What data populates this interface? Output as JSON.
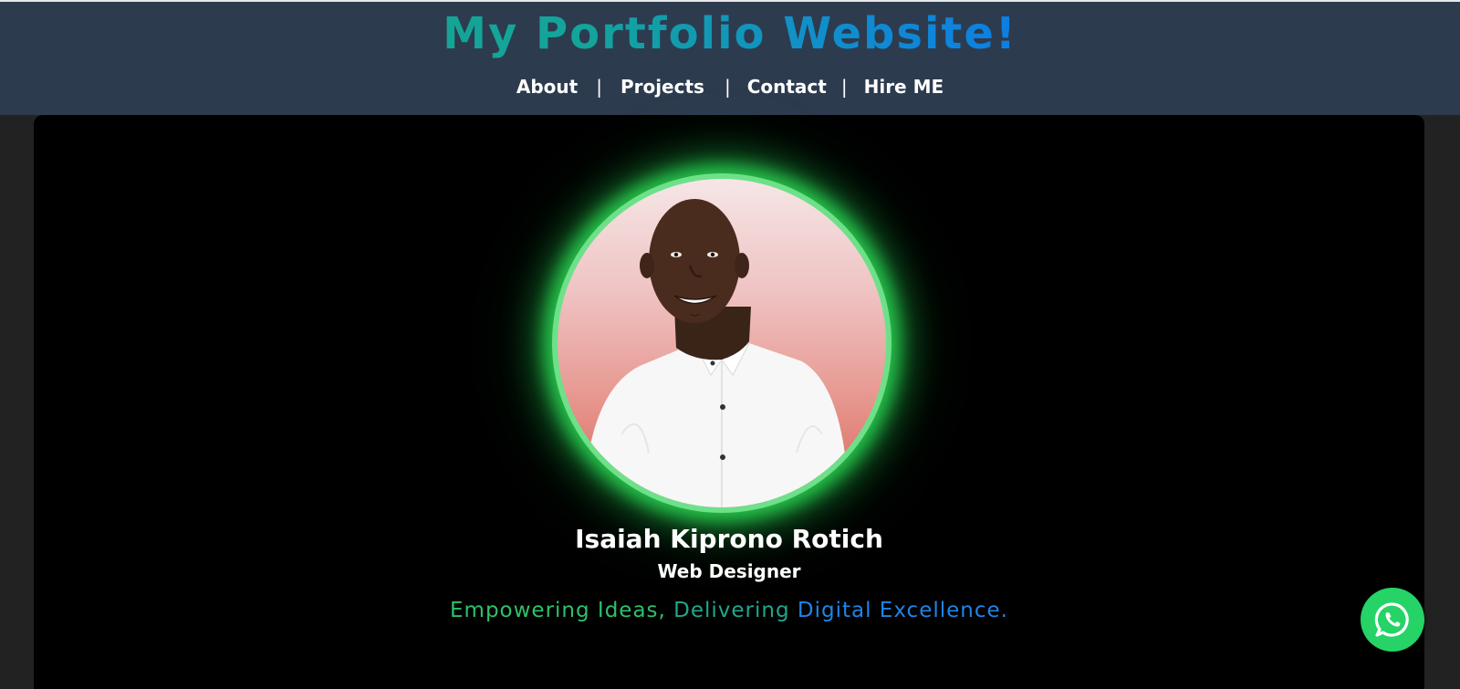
{
  "header": {
    "title_parts": [
      "My ",
      "Portfolio ",
      "Website!"
    ],
    "nav": {
      "items": [
        {
          "label": "About"
        },
        {
          "label": "Projects"
        },
        {
          "label": "Contact"
        },
        {
          "label": "Hire ME"
        }
      ],
      "separator": "|"
    }
  },
  "hero": {
    "name": "Isaiah Kiprono Rotich",
    "role": "Web Designer",
    "tagline_parts": [
      "Empowering Ideas, ",
      "Delivering ",
      "Digital Excellence."
    ],
    "glow_color": "#27c24a"
  },
  "floating": {
    "whatsapp_icon": "whatsapp-icon",
    "whatsapp_color": "#25d366"
  }
}
